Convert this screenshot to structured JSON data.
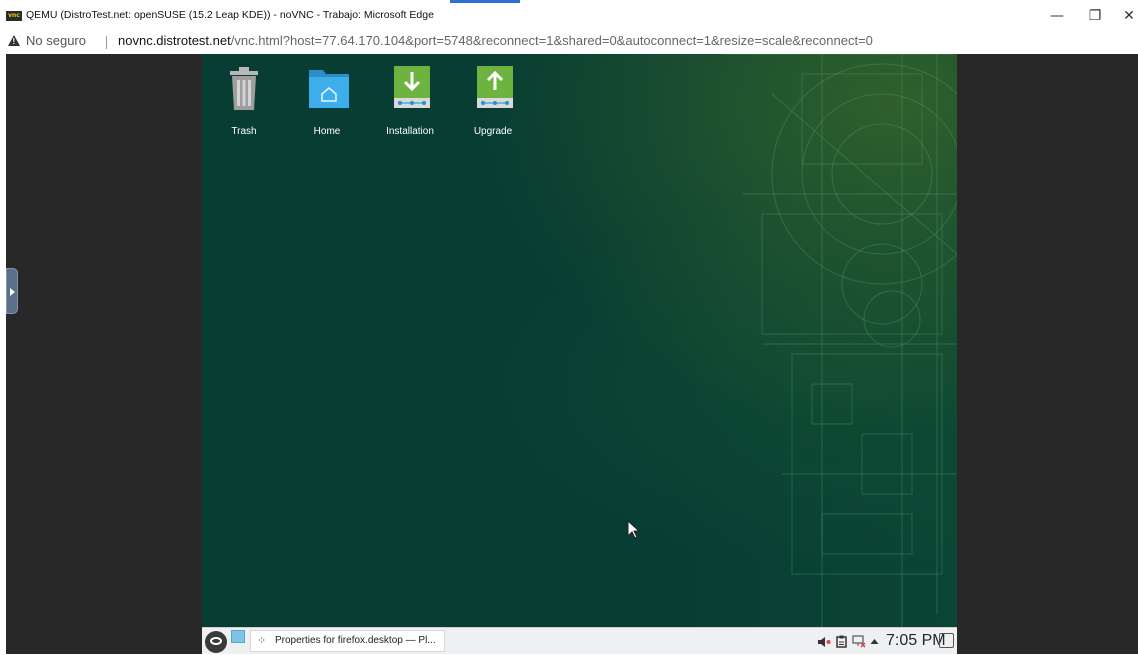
{
  "browser": {
    "window_title": "QEMU (DistroTest.net: openSUSE (15.2 Leap KDE)) - noVNC - Trabajo: Microsoft Edge",
    "vnc_logo_text": "vnc",
    "minimize_glyph": "—",
    "restore_glyph": "❐",
    "close_glyph": "✕",
    "security_label": "No seguro",
    "url_host": "novnc.distrotest.net",
    "url_path": "/vnc.html?host=77.64.170.104&port=5748&reconnect=1&shared=0&autoconnect=1&resize=scale&reconnect=0"
  },
  "desktop": {
    "icons": [
      {
        "label": "Trash",
        "icon": "trash-icon"
      },
      {
        "label": "Home",
        "icon": "home-folder-icon"
      },
      {
        "label": "Installation",
        "icon": "install-down-arrow-icon"
      },
      {
        "label": "Upgrade",
        "icon": "upgrade-up-arrow-icon"
      }
    ]
  },
  "taskbar": {
    "task_label": "Properties for firefox.desktop — Pl...",
    "clock": "7:05 PM",
    "tray_icons": [
      "volume-icon",
      "clipboard-icon",
      "network-disconnected-icon",
      "expand-tray-icon"
    ]
  },
  "colors": {
    "desktop_bg": "#073d33",
    "taskbar_bg": "#eff0f1",
    "install_green": "#6db33f",
    "home_folder_blue": "#3daee9"
  }
}
